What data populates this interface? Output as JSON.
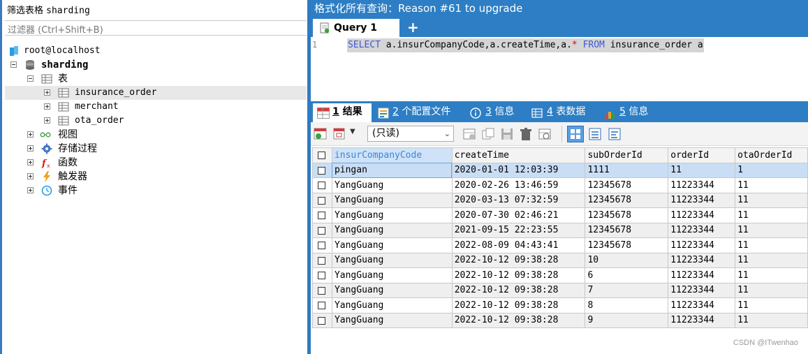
{
  "left_panel": {
    "title_cn": "筛选表格",
    "title_db": "sharding",
    "filter_placeholder": "过滤器 (Ctrl+Shift+B)",
    "tree": {
      "connection": "root@localhost",
      "database": "sharding",
      "tables_folder": "表",
      "tables": [
        "insurance_order",
        "merchant",
        "ota_order"
      ],
      "views": "视图",
      "procedures": "存储过程",
      "functions": "函数",
      "triggers": "触发器",
      "events": "事件"
    }
  },
  "right_panel": {
    "window_title": "格式化所有查询：Reason #61 to upgrade",
    "query_tab": "Query 1",
    "add_tab": "+",
    "editor": {
      "line_number": "1",
      "kw_select": "SELECT",
      "sql_mid": " a.insurCompanyCode,a.createTime,a.",
      "star": "*",
      "kw_from": "FROM",
      "sql_end": " insurance_order a"
    },
    "result_tabs": [
      {
        "num": "1",
        "label": " 结果"
      },
      {
        "num": "2",
        "label": " 个配置文件"
      },
      {
        "num": "3",
        "label": " 信息"
      },
      {
        "num": "4",
        "label": " 表数据"
      },
      {
        "num": "5",
        "label": " 信息"
      }
    ],
    "toolbar": {
      "readonly_label": "(只读)"
    },
    "grid": {
      "columns": [
        "insurCompanyCode",
        "createTime",
        "subOrderId",
        "orderId",
        "otaOrderId"
      ],
      "rows": [
        [
          "pingan",
          "2020-01-01 12:03:39",
          "1111",
          "11",
          "1"
        ],
        [
          "YangGuang",
          "2020-02-26 13:46:59",
          "12345678",
          "11223344",
          "11"
        ],
        [
          "YangGuang",
          "2020-03-13 07:32:59",
          "12345678",
          "11223344",
          "11"
        ],
        [
          "YangGuang",
          "2020-07-30 02:46:21",
          "12345678",
          "11223344",
          "11"
        ],
        [
          "YangGuang",
          "2021-09-15 22:23:55",
          "12345678",
          "11223344",
          "11"
        ],
        [
          "YangGuang",
          "2022-08-09 04:43:41",
          "12345678",
          "11223344",
          "11"
        ],
        [
          "YangGuang",
          "2022-10-12 09:38:28",
          "10",
          "11223344",
          "11"
        ],
        [
          "YangGuang",
          "2022-10-12 09:38:28",
          "6",
          "11223344",
          "11"
        ],
        [
          "YangGuang",
          "2022-10-12 09:38:28",
          "7",
          "11223344",
          "11"
        ],
        [
          "YangGuang",
          "2022-10-12 09:38:28",
          "8",
          "11223344",
          "11"
        ],
        [
          "YangGuang",
          "2022-10-12 09:38:28",
          "9",
          "11223344",
          "11"
        ]
      ]
    }
  },
  "watermark": "CSDN @ITwenhao",
  "colors": {
    "accent": "#2d7ec4",
    "selected_row": "#c9def5",
    "keyword": "#3b57d6"
  }
}
